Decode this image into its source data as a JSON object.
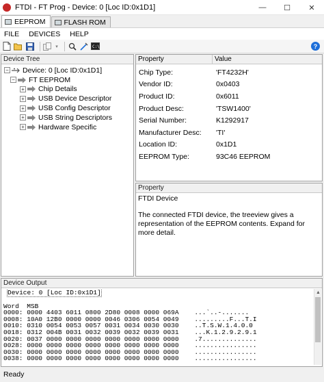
{
  "window": {
    "title": "FTDI - FT Prog - Device: 0 [Loc ID:0x1D1]"
  },
  "tabs": [
    {
      "label": "EEPROM",
      "active": true
    },
    {
      "label": "FLASH ROM",
      "active": false
    }
  ],
  "menu": [
    "FILE",
    "DEVICES",
    "HELP"
  ],
  "device_tree": {
    "header": "Device Tree",
    "device": "Device: 0 [Loc ID:0x1D1]",
    "eeprom": "FT EEPROM",
    "children": [
      "Chip Details",
      "USB Device Descriptor",
      "USB Config Descriptor",
      "USB String Descriptors",
      "Hardware Specific"
    ]
  },
  "properties": {
    "header_property": "Property",
    "header_value": "Value",
    "rows": [
      {
        "name": "Chip Type:",
        "value": "'FT4232H'"
      },
      {
        "name": "Vendor ID:",
        "value": "0x0403"
      },
      {
        "name": "Product ID:",
        "value": "0x6011"
      },
      {
        "name": "Product Desc:",
        "value": "'TSW1400'"
      },
      {
        "name": "Serial Number:",
        "value": "K1292917"
      },
      {
        "name": "Manufacturer Desc:",
        "value": "'TI'"
      },
      {
        "name": "Location ID:",
        "value": "0x1D1"
      },
      {
        "name": "EEPROM Type:",
        "value": "93C46 EEPROM"
      }
    ]
  },
  "description": {
    "header": "Property",
    "title": "FTDI Device",
    "body": "The connected FTDI device, the treeview gives a representation of the EEPROM contents.  Expand for more detail."
  },
  "output": {
    "header": "Device Output",
    "device_line": "Device: 0 [Loc ID:0x1D1]",
    "word_line": "Word  MSB",
    "lines": [
      "0000: 0000 4403 6011 0800 2D80 0008 0000 069A    ...`..-.......",
      "0008: 10A0 12B0 0000 0000 0046 0306 0054 0049    .........F...T.I",
      "0010: 0310 0054 0053 0057 0031 0034 0030 0030    ..T.S.W.1.4.0.0",
      "0018: 0312 004B 0031 0032 0039 0032 0039 0031    ...K.1.2.9.2.9.1",
      "0020: 0037 0000 0000 0000 0000 0000 0000 0000    .7..............",
      "0028: 0000 0000 0000 0000 0000 0000 0000 0000    ................",
      "0030: 0000 0000 0000 0000 0000 0000 0000 0000    ................",
      "0038: 0000 0000 0000 0000 0000 0000 0000 0000    ................"
    ]
  },
  "status": {
    "text": "Ready"
  },
  "colors": {
    "app_icon": "#c62828",
    "help_icon": "#1e6fd9"
  }
}
